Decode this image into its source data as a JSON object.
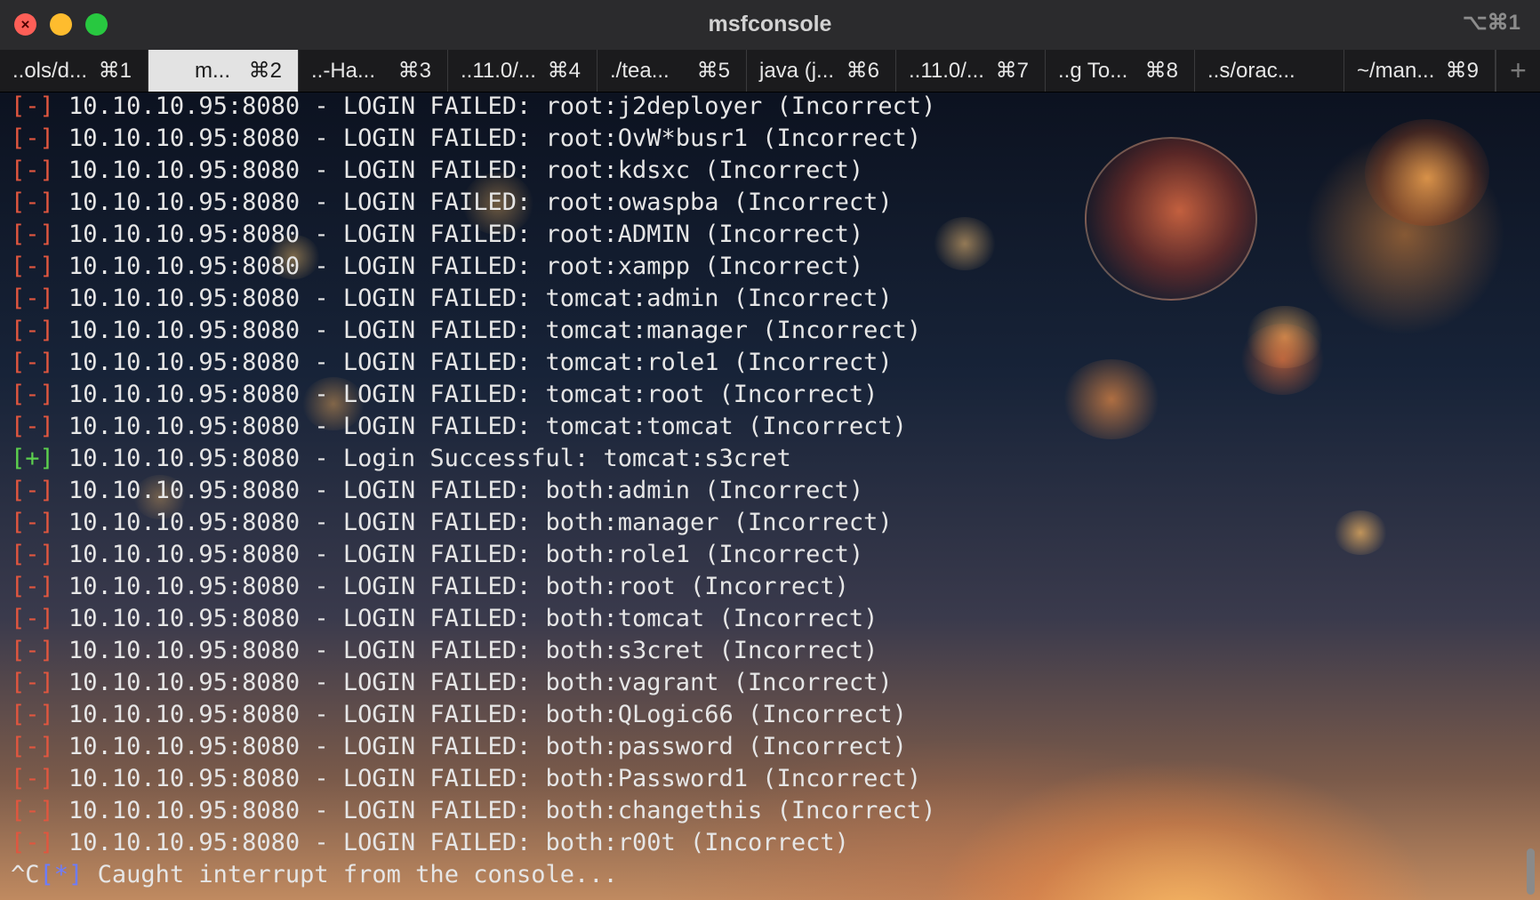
{
  "window": {
    "title": "msfconsole",
    "shortcut": "⌥⌘1",
    "close_glyph": "×",
    "colors": {
      "fail": "#e0563f",
      "success": "#5cd04e",
      "info": "#6c7cff",
      "text": "#e6e6e6"
    }
  },
  "tabs": [
    {
      "label": "..ols/d...",
      "key": "⌘1"
    },
    {
      "label": "m...",
      "key": "⌘2",
      "active": true
    },
    {
      "label": "..-Ha...",
      "key": "⌘3"
    },
    {
      "label": "..11.0/...",
      "key": "⌘4"
    },
    {
      "label": "./tea...",
      "key": "⌘5"
    },
    {
      "label": "java (j...",
      "key": "⌘6"
    },
    {
      "label": "..11.0/...",
      "key": "⌘7"
    },
    {
      "label": "..g To...",
      "key": "⌘8"
    },
    {
      "label": "..s/orac...",
      "key": ""
    },
    {
      "label": "~/man...",
      "key": "⌘9"
    }
  ],
  "new_tab_label": "+",
  "terminal": {
    "lines": [
      {
        "tag": "[-]",
        "type": "fail",
        "text": "10.10.10.95:8080 - LOGIN FAILED: root:j2deployer (Incorrect)"
      },
      {
        "tag": "[-]",
        "type": "fail",
        "text": "10.10.10.95:8080 - LOGIN FAILED: root:OvW*busr1 (Incorrect)"
      },
      {
        "tag": "[-]",
        "type": "fail",
        "text": "10.10.10.95:8080 - LOGIN FAILED: root:kdsxc (Incorrect)"
      },
      {
        "tag": "[-]",
        "type": "fail",
        "text": "10.10.10.95:8080 - LOGIN FAILED: root:owaspba (Incorrect)"
      },
      {
        "tag": "[-]",
        "type": "fail",
        "text": "10.10.10.95:8080 - LOGIN FAILED: root:ADMIN (Incorrect)"
      },
      {
        "tag": "[-]",
        "type": "fail",
        "text": "10.10.10.95:8080 - LOGIN FAILED: root:xampp (Incorrect)"
      },
      {
        "tag": "[-]",
        "type": "fail",
        "text": "10.10.10.95:8080 - LOGIN FAILED: tomcat:admin (Incorrect)"
      },
      {
        "tag": "[-]",
        "type": "fail",
        "text": "10.10.10.95:8080 - LOGIN FAILED: tomcat:manager (Incorrect)"
      },
      {
        "tag": "[-]",
        "type": "fail",
        "text": "10.10.10.95:8080 - LOGIN FAILED: tomcat:role1 (Incorrect)"
      },
      {
        "tag": "[-]",
        "type": "fail",
        "text": "10.10.10.95:8080 - LOGIN FAILED: tomcat:root (Incorrect)"
      },
      {
        "tag": "[-]",
        "type": "fail",
        "text": "10.10.10.95:8080 - LOGIN FAILED: tomcat:tomcat (Incorrect)"
      },
      {
        "tag": "[+]",
        "type": "ok",
        "text": "10.10.10.95:8080 - Login Successful: tomcat:s3cret"
      },
      {
        "tag": "[-]",
        "type": "fail",
        "text": "10.10.10.95:8080 - LOGIN FAILED: both:admin (Incorrect)"
      },
      {
        "tag": "[-]",
        "type": "fail",
        "text": "10.10.10.95:8080 - LOGIN FAILED: both:manager (Incorrect)"
      },
      {
        "tag": "[-]",
        "type": "fail",
        "text": "10.10.10.95:8080 - LOGIN FAILED: both:role1 (Incorrect)"
      },
      {
        "tag": "[-]",
        "type": "fail",
        "text": "10.10.10.95:8080 - LOGIN FAILED: both:root (Incorrect)"
      },
      {
        "tag": "[-]",
        "type": "fail",
        "text": "10.10.10.95:8080 - LOGIN FAILED: both:tomcat (Incorrect)"
      },
      {
        "tag": "[-]",
        "type": "fail",
        "text": "10.10.10.95:8080 - LOGIN FAILED: both:s3cret (Incorrect)"
      },
      {
        "tag": "[-]",
        "type": "fail",
        "text": "10.10.10.95:8080 - LOGIN FAILED: both:vagrant (Incorrect)"
      },
      {
        "tag": "[-]",
        "type": "fail",
        "text": "10.10.10.95:8080 - LOGIN FAILED: both:QLogic66 (Incorrect)"
      },
      {
        "tag": "[-]",
        "type": "fail",
        "text": "10.10.10.95:8080 - LOGIN FAILED: both:password (Incorrect)"
      },
      {
        "tag": "[-]",
        "type": "fail",
        "text": "10.10.10.95:8080 - LOGIN FAILED: both:Password1 (Incorrect)"
      },
      {
        "tag": "[-]",
        "type": "fail",
        "text": "10.10.10.95:8080 - LOGIN FAILED: both:changethis (Incorrect)"
      },
      {
        "tag": "[-]",
        "type": "fail",
        "text": "10.10.10.95:8080 - LOGIN FAILED: both:r00t (Incorrect)"
      },
      {
        "prefix": "^C",
        "tag": "[*]",
        "type": "info",
        "text": "Caught interrupt from the console..."
      }
    ]
  }
}
